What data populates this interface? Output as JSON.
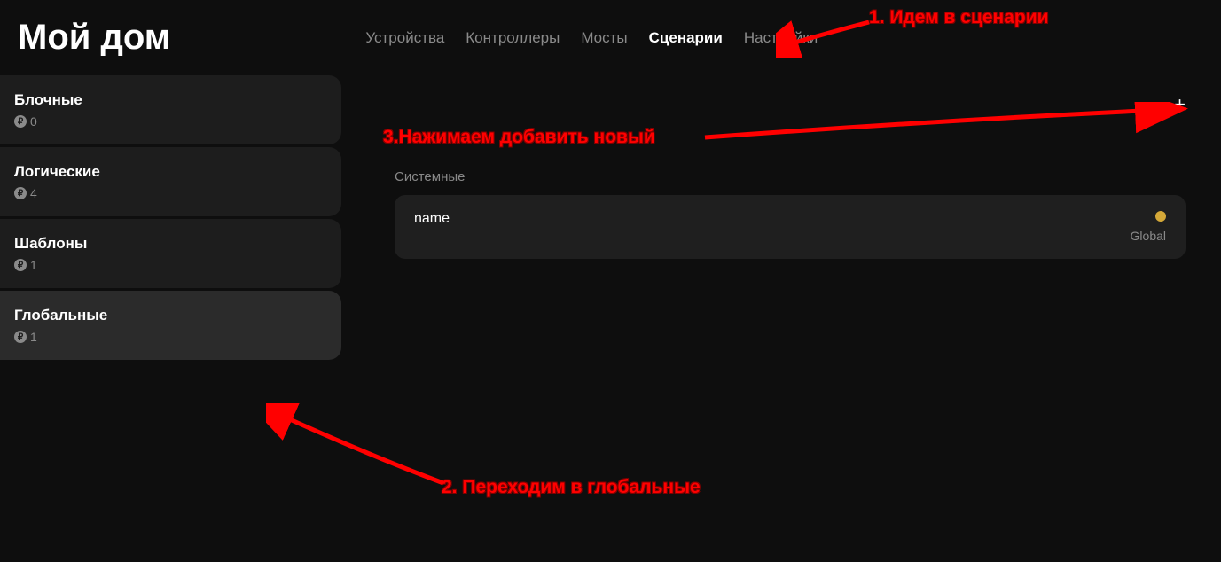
{
  "header": {
    "title": "Мой дом"
  },
  "nav": {
    "items": [
      {
        "label": "Устройства",
        "active": false
      },
      {
        "label": "Контроллеры",
        "active": false
      },
      {
        "label": "Мосты",
        "active": false
      },
      {
        "label": "Сценарии",
        "active": true
      },
      {
        "label": "Настройки",
        "active": false
      }
    ]
  },
  "sidebar": {
    "items": [
      {
        "title": "Блочные",
        "count": "0",
        "active": false
      },
      {
        "title": "Логические",
        "count": "4",
        "active": false
      },
      {
        "title": "Шаблоны",
        "count": "1",
        "active": false
      },
      {
        "title": "Глобальные",
        "count": "1",
        "active": true
      }
    ]
  },
  "main": {
    "add_icon": "+",
    "section_label": "Системные",
    "card": {
      "name": "name",
      "tag": "Global",
      "status_color": "#d4a838"
    }
  },
  "annotations": {
    "a1": "1. Идем в сценарии",
    "a2": "2. Переходим в глобальные",
    "a3": "3.Нажимаем добавить новый"
  }
}
